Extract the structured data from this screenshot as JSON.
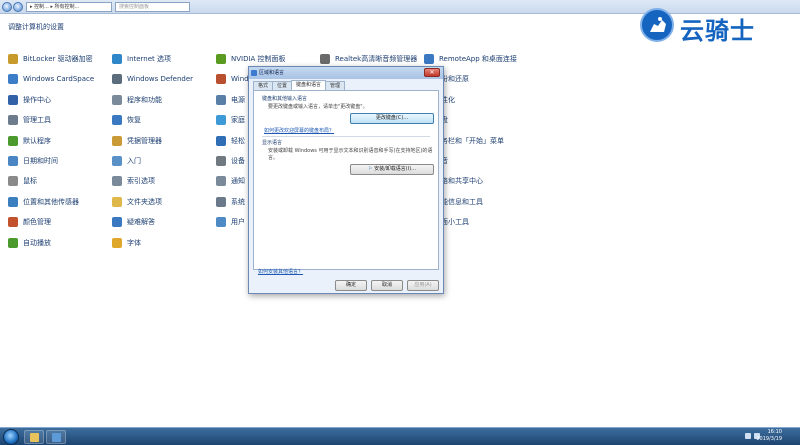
{
  "window": {
    "address": "▸ 控制... ▸ 所有控制...",
    "search_placeholder": "搜索控制面板",
    "page_title": "调整计算机的设置"
  },
  "logo": {
    "text": "云骑士"
  },
  "items": [
    {
      "label": "BitLocker 驱动器加密",
      "icon": "key-icon",
      "color": "#c79a2b"
    },
    {
      "label": "Internet 选项",
      "icon": "globe-icon",
      "color": "#2f86c9"
    },
    {
      "label": "NVIDIA 控制面板",
      "icon": "nvidia-icon",
      "color": "#5a9a1e"
    },
    {
      "label": "Realtek高清晰音频管理器",
      "icon": "speaker-icon",
      "color": "#6a6a6a"
    },
    {
      "label": "RemoteApp 和桌面连接",
      "icon": "remote-desktop-icon",
      "color": "#3a78c2"
    },
    {
      "label": "Windows CardSpace",
      "icon": "cardspace-icon",
      "color": "#3c7dc8"
    },
    {
      "label": "Windows Defender",
      "icon": "defender-icon",
      "color": "#5b6d7c"
    },
    {
      "label": "Wind",
      "icon": "firewall-icon",
      "color": "#b8502f"
    },
    {
      "label": "备份和还原",
      "icon": "backup-icon",
      "color": "#4e9a3a"
    },
    {
      "label": "操作中心",
      "icon": "flag-icon",
      "color": "#3261a8"
    },
    {
      "label": "程序和功能",
      "icon": "programs-icon",
      "color": "#7a8a9a"
    },
    {
      "label": "电源",
      "icon": "power-icon",
      "color": "#5a7fa6"
    },
    {
      "label": "个性化",
      "icon": "personalize-icon",
      "color": "#c24d8d"
    },
    {
      "label": "管理工具",
      "icon": "admin-tools-icon",
      "color": "#6c7c8c"
    },
    {
      "label": "恢复",
      "icon": "recovery-icon",
      "color": "#3a78c2"
    },
    {
      "label": "家庭",
      "icon": "homegroup-icon",
      "color": "#3e9ad6"
    },
    {
      "label": "键盘",
      "icon": "keyboard-icon",
      "color": "#777777"
    },
    {
      "label": "默认程序",
      "icon": "default-programs-icon",
      "color": "#4c9a2e"
    },
    {
      "label": "凭据管理器",
      "icon": "credentials-icon",
      "color": "#c99a35"
    },
    {
      "label": "轻松",
      "icon": "ease-access-icon",
      "color": "#2f6db5"
    },
    {
      "label": "任务栏和「开始」菜单",
      "icon": "taskbar-icon",
      "color": "#3565a5"
    },
    {
      "label": "日期和时间",
      "icon": "clock-icon",
      "color": "#4a86c4"
    },
    {
      "label": "入门",
      "icon": "getting-started-icon",
      "color": "#5a90c8"
    },
    {
      "label": "设备",
      "icon": "devices-icon",
      "color": "#707880"
    },
    {
      "label": "声音",
      "icon": "sound-icon",
      "color": "#7c7c7c"
    },
    {
      "label": "鼠标",
      "icon": "mouse-icon",
      "color": "#8a8a8a"
    },
    {
      "label": "索引选项",
      "icon": "index-icon",
      "color": "#7a8a9a"
    },
    {
      "label": "通知",
      "icon": "notification-icon",
      "color": "#7a8a9a"
    },
    {
      "label": "网络和共享中心",
      "icon": "network-icon",
      "color": "#3a78c2"
    },
    {
      "label": "位置和其他传感器",
      "icon": "location-icon",
      "color": "#3c7fbf"
    },
    {
      "label": "文件夹选项",
      "icon": "folder-icon",
      "color": "#e0b84a"
    },
    {
      "label": "系统",
      "icon": "system-icon",
      "color": "#6a7a8a"
    },
    {
      "label": "性能信息和工具",
      "icon": "performance-icon",
      "color": "#5a8a3a"
    },
    {
      "label": "颜色管理",
      "icon": "color-icon",
      "color": "#c2522d"
    },
    {
      "label": "疑难解答",
      "icon": "troubleshoot-icon",
      "color": "#3a78c2"
    },
    {
      "label": "用户",
      "icon": "users-icon",
      "color": "#4e8bc4"
    },
    {
      "label": "桌面小工具",
      "icon": "gadgets-icon",
      "color": "#3a78c2"
    },
    {
      "label": "自动播放",
      "icon": "autoplay-icon",
      "color": "#4c9a2e"
    },
    {
      "label": "字体",
      "icon": "font-icon",
      "color": "#e0a82a"
    }
  ],
  "dialog": {
    "title": "区域和语言",
    "close": "✕",
    "tabs": [
      "格式",
      "位置",
      "键盘和语言",
      "管理"
    ],
    "keyboard_group": "键盘和其他输入语言",
    "keyboard_desc": "要更改键盘或输入语言，请单击\"更改键盘\"。",
    "change_keyboard_button": "更改键盘(C)...",
    "keyboard_link": "如何更改欢迎屏幕的键盘布局？",
    "display_group": "显示语言",
    "display_desc_1": "安装或卸载 Windows 可用于显示文本和识别语音和手写(在支持地区)的语",
    "display_desc_2": "言。",
    "install_button": "安装/卸载语言(I)...",
    "bottom_link": "如何安装其他语言？",
    "ok": "确定",
    "cancel": "取消",
    "apply": "应用(A)"
  },
  "taskbar": {
    "time": "16:10",
    "date": "2019/3/19"
  }
}
